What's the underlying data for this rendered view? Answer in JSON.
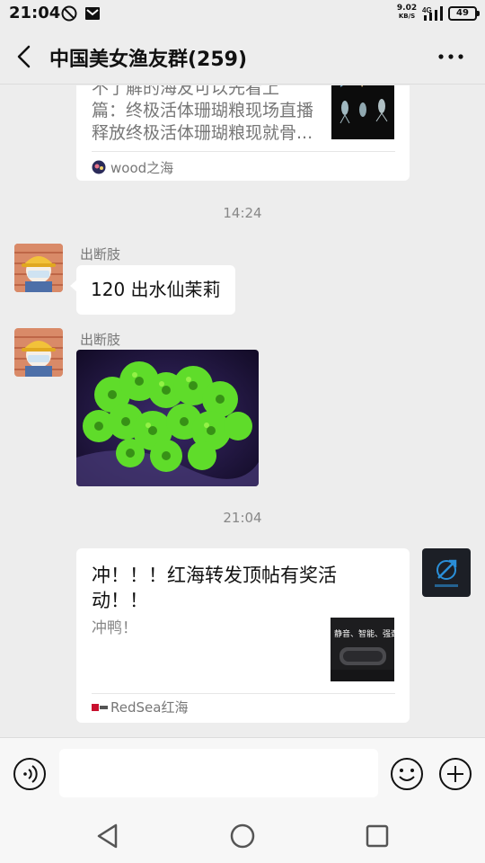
{
  "status_bar": {
    "time": "21:04",
    "net_speed": "9.02",
    "net_unit": "KB/S",
    "network_type": "4G",
    "battery": "49",
    "icons": [
      "alarm-icon",
      "mail-icon",
      "signal-icon",
      "battery-icon"
    ]
  },
  "header": {
    "title": "中国美女渔友群(259)",
    "back_icon": "back-chevron-icon",
    "more_icon": "more-dots-icon"
  },
  "messages": {
    "top_card": {
      "partial_line": "不了解的海友可以先看上",
      "desc_line1": "篇：终极活体珊瑚粮现场直播",
      "desc_line2": "释放终极活体珊瑚粮现就骨...",
      "source": "wood之海"
    },
    "time1": "14:24",
    "msg1": {
      "sender": "出断肢",
      "text": "120 出水仙茉莉"
    },
    "msg2": {
      "sender": "出断肢"
    },
    "time2": "21:04",
    "bottom_card": {
      "title_line1": "冲！！！红海转发顶帖有奖活",
      "title_line2": "动！！",
      "desc": "冲鸭！",
      "thumb_text": "静音、智能、强劲",
      "source": "RedSea红海"
    }
  },
  "input_bar": {
    "voice_icon": "voice-icon",
    "input_value": "",
    "emoji_icon": "emoji-icon",
    "plus_icon": "plus-icon"
  },
  "nav_bar": {
    "icons": [
      "nav-back-icon",
      "nav-home-icon",
      "nav-recents-icon"
    ]
  },
  "colors": {
    "background": "#ededed",
    "bubble": "#ffffff",
    "coral_green": "#5fdc2a"
  }
}
